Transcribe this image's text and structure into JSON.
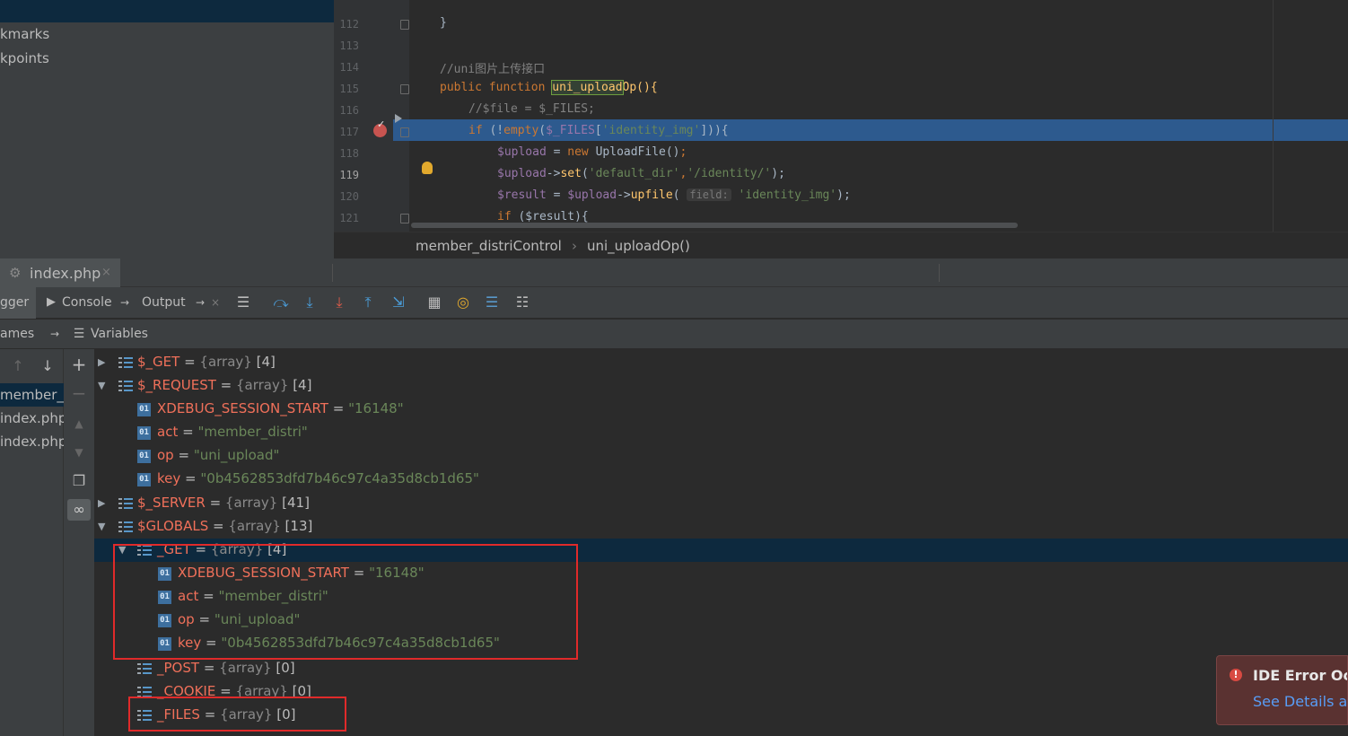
{
  "project_panel": {
    "items": [
      "kmarks",
      "kpoints"
    ]
  },
  "editor": {
    "lines": [
      {
        "num": "112",
        "text": "}"
      },
      {
        "num": "113",
        "text": ""
      },
      {
        "num": "114",
        "text": "//uni图片上传接口"
      },
      {
        "num": "115",
        "text": "public function uni_uploadOp(){"
      },
      {
        "num": "116",
        "text": "//$file = $_FILES;"
      },
      {
        "num": "117",
        "text": "if (!empty($_FILES['identity_img'])){"
      },
      {
        "num": "118",
        "text": "$upload = new UploadFile();"
      },
      {
        "num": "119",
        "text": "$upload->set('default_dir','/identity/');"
      },
      {
        "num": "120",
        "text": "$result = $upload->upfile( field: 'identity_img');"
      },
      {
        "num": "121",
        "text": "if ($result){"
      }
    ],
    "tokens": {
      "comment_114": "//uni图片上传接口",
      "public": "public",
      "function": "function",
      "fn_name": "uni_upload",
      "fn_rest": "Op(){",
      "comment_116": "//$file = $_FILES;",
      "if": "if",
      "paren_not": " (!",
      "empty": "empty",
      "paren2": "(",
      "files_var": "$_FILES",
      "bracket_open": "[",
      "identity_img_str": "'identity_img'",
      "close_117": "])){",
      "upload_var": "$upload",
      "eq": " = ",
      "new": "new",
      "uploadfile": " UploadFile()",
      "semi": ";",
      "arrow": "->",
      "set": "set",
      "default_dir": "'default_dir'",
      "comma": ",",
      "identity_path": "'/identity/'",
      "close_set": ");",
      "result_var": "$result",
      "upfile": "upfile",
      "open_paren": "(",
      "field_hint": "field:",
      "identity_img_str2": "'identity_img'",
      "close_upfile": ");",
      "if_121": "if",
      "result_cond": " ($result){",
      "brace_112": "}"
    }
  },
  "breadcrumb": {
    "class_name": "member_distriControl",
    "separator": "›",
    "method_name": "uni_uploadOp()"
  },
  "tabs": {
    "active_file": "index.php",
    "close_glyph": "×"
  },
  "debugger": {
    "tab_debugger": "gger",
    "tab_console": "Console",
    "tab_output": "Output",
    "frames_label": "ames",
    "variables_label": "Variables"
  },
  "frames": [
    "member_d",
    "index.php:",
    "index.php:"
  ],
  "variables": [
    {
      "name": "$_GET",
      "type": "{array}",
      "count": "[4]"
    },
    {
      "name": "$_REQUEST",
      "type": "{array}",
      "count": "[4]"
    },
    {
      "name": "XDEBUG_SESSION_START",
      "value": "\"16148\""
    },
    {
      "name": "act",
      "value": "\"member_distri\""
    },
    {
      "name": "op",
      "value": "\"uni_upload\""
    },
    {
      "name": "key",
      "value": "\"0b4562853dfd7b46c97c4a35d8cb1d65\""
    },
    {
      "name": "$_SERVER",
      "type": "{array}",
      "count": "[41]"
    },
    {
      "name": "$GLOBALS",
      "type": "{array}",
      "count": "[13]"
    },
    {
      "name": "_GET",
      "type": "{array}",
      "count": "[4]"
    },
    {
      "name": "XDEBUG_SESSION_START",
      "value": "\"16148\""
    },
    {
      "name": "act",
      "value": "\"member_distri\""
    },
    {
      "name": "op",
      "value": "\"uni_upload\""
    },
    {
      "name": "key",
      "value": "\"0b4562853dfd7b46c97c4a35d8cb1d65\""
    },
    {
      "name": "_POST",
      "type": "{array}",
      "count": "[0]"
    },
    {
      "name": "_COOKIE",
      "type": "{array}",
      "count": "[0]"
    },
    {
      "name": "_FILES",
      "type": "{array}",
      "count": "[0]"
    }
  ],
  "equals": " = ",
  "error_popup": {
    "title": "IDE Error Occu",
    "link": "See Details and"
  },
  "colors": {
    "execution_line": "#2d5a8e",
    "annotation_red": "#e02a2a",
    "var_name": "#f0705a",
    "string_value": "#6a8759"
  },
  "icons": {
    "breakpoint": "breakpoint-icon",
    "intention_bulb": "lightbulb-icon",
    "php_file": "php-file-icon"
  }
}
